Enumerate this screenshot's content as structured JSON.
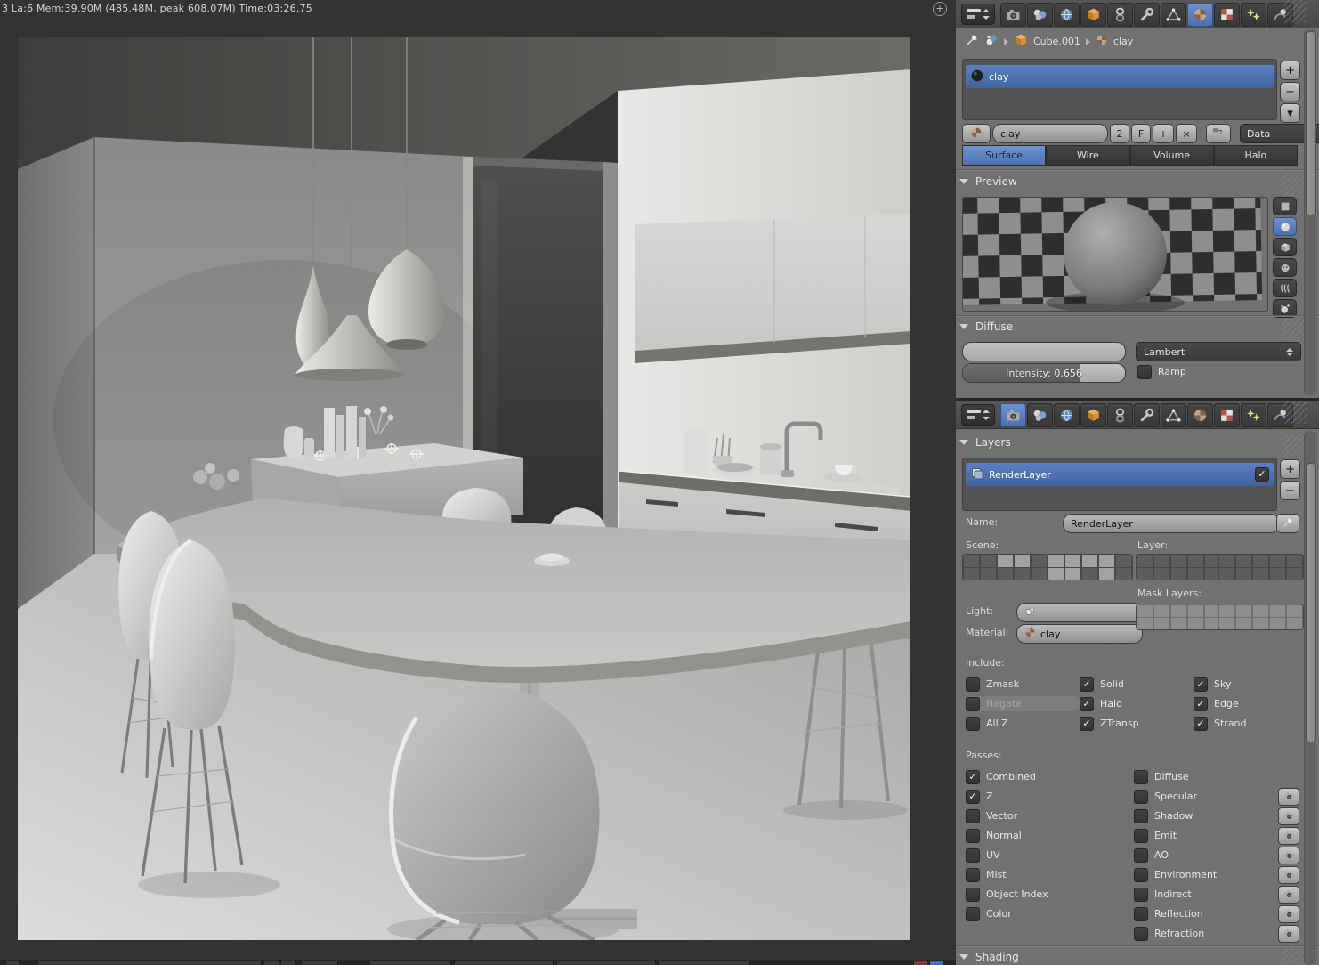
{
  "viewport": {
    "stats": "3 La:6 Mem:39.90M (485.48M, peak 608.07M) Time:03:26.75"
  },
  "glyphs": {
    "add": "+",
    "remove": "−",
    "down": "▾",
    "close": "×",
    "check": "✓"
  },
  "material_editor": {
    "tabs": [
      "render",
      "render-layers",
      "world",
      "object",
      "constraints",
      "modifiers",
      "object-data",
      "material",
      "texture",
      "particles",
      "physics"
    ],
    "active_tab": "material",
    "breadcrumb": {
      "object": "Cube.001",
      "material": "clay"
    },
    "slot_list": {
      "items": [
        {
          "name": "clay",
          "selected": true
        }
      ]
    },
    "datablock": {
      "name": "clay",
      "users": "2",
      "fake_user": "F",
      "dropdown": "Data"
    },
    "type_tabs": {
      "labels": [
        "Surface",
        "Wire",
        "Volume",
        "Halo"
      ],
      "active": "Surface"
    },
    "preview": {
      "title": "Preview",
      "modes": [
        "flat",
        "sphere",
        "cube",
        "monkey",
        "hair",
        "sky"
      ],
      "active_mode": "sphere"
    },
    "diffuse": {
      "title": "Diffuse",
      "shader": "Lambert",
      "intensity_label": "Intensity: 0.656",
      "intensity_fill": 0.72,
      "ramp_label": "Ramp"
    }
  },
  "render_editor": {
    "tabs": [
      "render",
      "render-layers",
      "world",
      "object",
      "constraints",
      "modifiers",
      "object-data",
      "material",
      "texture",
      "particles",
      "physics"
    ],
    "active_tab": "render",
    "layers": {
      "title": "Layers",
      "list": [
        {
          "name": "RenderLayer",
          "selected": true,
          "checked": true
        }
      ],
      "name_label": "Name:",
      "name_value": "RenderLayer",
      "scene_label": "Scene:",
      "layer_label": "Layer:",
      "scene_grid_a": [
        [
          0,
          0,
          1,
          1,
          0
        ],
        [
          0,
          0,
          0,
          0,
          0
        ]
      ],
      "scene_grid_b": [
        [
          1,
          1,
          1,
          1,
          0
        ],
        [
          1,
          1,
          0,
          1,
          0
        ]
      ],
      "layer_grid_a": [
        [
          0,
          0,
          0,
          0,
          0
        ],
        [
          0,
          0,
          0,
          0,
          0
        ]
      ],
      "layer_grid_b": [
        [
          0,
          0,
          0,
          0,
          0
        ],
        [
          0,
          0,
          0,
          0,
          0
        ]
      ],
      "mask_label": "Mask Layers:",
      "mask_grid_a": [
        [
          0,
          0,
          0,
          0,
          0
        ],
        [
          0,
          0,
          0,
          0,
          0
        ]
      ],
      "mask_grid_b": [
        [
          0,
          0,
          0,
          0,
          0
        ],
        [
          0,
          0,
          0,
          0,
          0
        ]
      ],
      "light_label": "Light:",
      "light_value": "",
      "material_label": "Material:",
      "material_value": "clay",
      "include_label": "Include:",
      "include": [
        {
          "label": "Zmask",
          "checked": false
        },
        {
          "label": "Negate",
          "checked": false,
          "disabled": true
        },
        {
          "label": "All Z",
          "checked": false
        },
        {
          "label": "Solid",
          "checked": true
        },
        {
          "label": "Halo",
          "checked": true
        },
        {
          "label": "ZTransp",
          "checked": true
        },
        {
          "label": "Sky",
          "checked": true
        },
        {
          "label": "Edge",
          "checked": true
        },
        {
          "label": "Strand",
          "checked": true
        }
      ],
      "passes_label": "Passes:",
      "passes_left": [
        {
          "label": "Combined",
          "checked": true
        },
        {
          "label": "Z",
          "checked": true
        },
        {
          "label": "Vector",
          "checked": false
        },
        {
          "label": "Normal",
          "checked": false
        },
        {
          "label": "UV",
          "checked": false
        },
        {
          "label": "Mist",
          "checked": false
        },
        {
          "label": "Object Index",
          "checked": false
        },
        {
          "label": "Color",
          "checked": false
        }
      ],
      "passes_right": [
        {
          "label": "Diffuse",
          "checked": false,
          "camera": false
        },
        {
          "label": "Specular",
          "checked": false,
          "camera": true
        },
        {
          "label": "Shadow",
          "checked": false,
          "camera": true
        },
        {
          "label": "Emit",
          "checked": false,
          "camera": true
        },
        {
          "label": "AO",
          "checked": false,
          "camera": true
        },
        {
          "label": "Environment",
          "checked": false,
          "camera": true
        },
        {
          "label": "Indirect",
          "checked": false,
          "camera": true
        },
        {
          "label": "Reflection",
          "checked": false,
          "camera": true
        },
        {
          "label": "Refraction",
          "checked": false,
          "camera": true
        }
      ]
    },
    "shading_title": "Shading"
  }
}
